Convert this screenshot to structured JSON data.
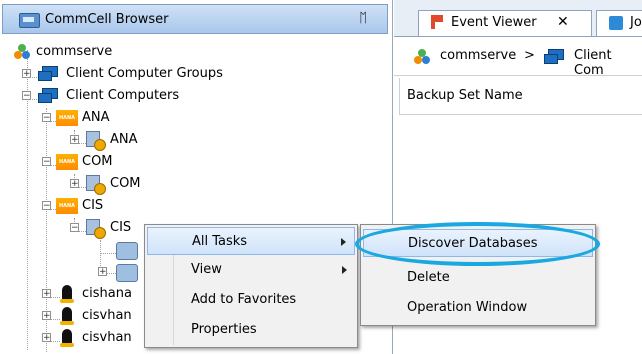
{
  "left_panel": {
    "title": "CommCell Browser",
    "pin_glyph": "ᛖ"
  },
  "tree": {
    "commserve": "commserve",
    "client_computer_groups": "Client Computer Groups",
    "client_computers": "Client Computers",
    "ana_group": "ANA",
    "ana_server": "ANA",
    "com_group": "COM",
    "com_server": "COM",
    "cis_group": "CIS",
    "cis_server": "CIS",
    "linux1": "cishana",
    "linux2": "cisvhan",
    "linux3": "cisvhan"
  },
  "tabs": [
    {
      "label": "Event Viewer",
      "close": "✕"
    },
    {
      "label": "Jo"
    }
  ],
  "breadcrumb": {
    "item1": "commserve",
    "sep": ">",
    "item2": "Client Com"
  },
  "grid": {
    "column_header": "Backup Set Name"
  },
  "context_menu": {
    "items": [
      "All Tasks",
      "View",
      "Add to Favorites",
      "Properties"
    ]
  },
  "submenu": {
    "items": [
      "Discover Databases",
      "Delete",
      "Operation Window"
    ]
  },
  "colors": {
    "callout": "#1aa8e0",
    "header_gradient_top": "#cfe1f5",
    "header_gradient_bottom": "#a9c7ec"
  }
}
